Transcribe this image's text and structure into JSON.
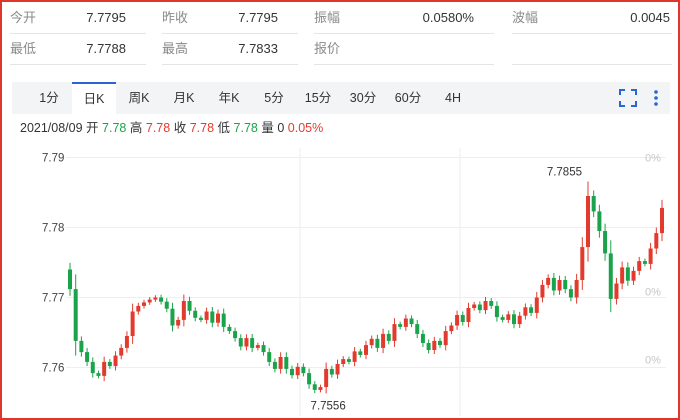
{
  "header": {
    "row1": [
      {
        "label": "今开",
        "value": "7.7795"
      },
      {
        "label": "昨收",
        "value": "7.7795"
      },
      {
        "label": "振幅",
        "value": "0.0580%"
      },
      {
        "label": "波幅",
        "value": "0.0045"
      }
    ],
    "row2": [
      {
        "label": "最低",
        "value": "7.7788"
      },
      {
        "label": "最高",
        "value": "7.7833"
      },
      {
        "label": "报价",
        "value": ""
      }
    ]
  },
  "tabs": [
    "1分",
    "日K",
    "周K",
    "月K",
    "年K",
    "5分",
    "15分",
    "30分",
    "60分",
    "4H"
  ],
  "active_tab": 1,
  "icons": {
    "fullscreen": "fullscreen-icon",
    "more": "more-vertical-icon"
  },
  "info": {
    "date": "2021/08/09",
    "open_label": "开",
    "open": "7.78",
    "high_label": "高",
    "high": "7.78",
    "close_label": "收",
    "close": "7.78",
    "low_label": "低",
    "low": "7.78",
    "vol_label": "量",
    "vol": "0",
    "change": "0.05%"
  },
  "colors": {
    "up": "#e23b2e",
    "down": "#1aa34a",
    "accent": "#2a64d6",
    "frame": "#e0352b"
  },
  "chart_data": {
    "type": "candlestick",
    "y_ticks": [
      "7.79",
      "7.78",
      "7.77",
      "7.76"
    ],
    "y_tick_values": [
      7.79,
      7.78,
      7.77,
      7.76
    ],
    "right_ticks": [
      "0%",
      "0%",
      "0%"
    ],
    "ylim": [
      7.7545,
      7.7905
    ],
    "max_label": "7.7855",
    "min_label": "7.7556",
    "closes": [
      7.7712,
      7.7638,
      7.7622,
      7.7608,
      7.7592,
      7.7588,
      7.7608,
      7.7602,
      7.7617,
      7.7628,
      7.7645,
      7.768,
      7.7688,
      7.7693,
      7.7697,
      7.77,
      7.7694,
      7.7684,
      7.766,
      7.7668,
      7.7695,
      7.7681,
      7.7671,
      7.7668,
      7.768,
      7.7664,
      7.7677,
      7.7658,
      7.7652,
      7.7642,
      7.763,
      7.7642,
      7.7628,
      7.7632,
      7.7622,
      7.7608,
      7.7598,
      7.7615,
      7.7598,
      7.7589,
      7.7601,
      7.7592,
      7.7576,
      7.7568,
      7.7572,
      7.7598,
      7.759,
      7.7605,
      7.7612,
      7.7608,
      7.7623,
      7.7618,
      7.7632,
      7.7641,
      7.7628,
      7.7648,
      7.7638,
      7.7662,
      7.7658,
      7.767,
      7.7662,
      7.7648,
      7.7635,
      7.7625,
      7.7638,
      7.7632,
      7.7652,
      7.766,
      7.7675,
      7.7665,
      7.7685,
      7.769,
      7.7682,
      7.7695,
      7.7688,
      7.7672,
      7.7668,
      7.7676,
      7.7662,
      7.7674,
      7.7686,
      7.7678,
      7.77,
      7.7718,
      7.7728,
      7.771,
      7.7725,
      7.7712,
      7.77,
      7.7725,
      7.7772,
      7.7845,
      7.7823,
      7.7795,
      7.7763,
      7.7698,
      7.772,
      7.7743,
      7.7724,
      7.7738,
      7.7752,
      7.7748,
      7.777,
      7.7792,
      7.7828
    ]
  }
}
